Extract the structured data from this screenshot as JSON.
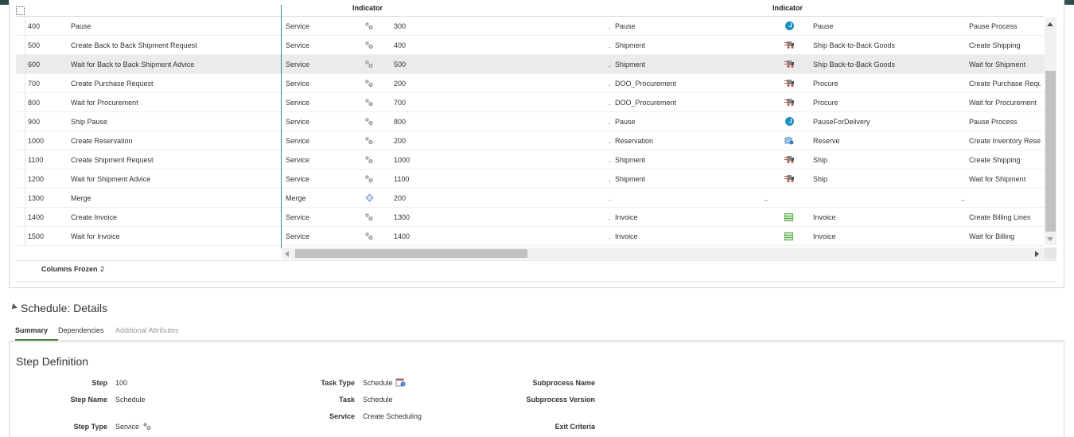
{
  "header": {
    "indicator_col_1": "Indicator",
    "indicator_col_2": "Indicator"
  },
  "rows": [
    {
      "step": "400",
      "name": "Pause",
      "type": "Service",
      "pred": "300",
      "task_type": "Pause",
      "ind": "clock",
      "task": "Pause",
      "service": "Pause Process"
    },
    {
      "step": "500",
      "name": "Create Back to Back Shipment Request",
      "type": "Service",
      "pred": "400",
      "task_type": "Shipment",
      "ind": "truck",
      "task": "Ship Back-to-Back Goods",
      "service": "Create Shipping"
    },
    {
      "step": "600",
      "name": "Wait for Back to Back Shipment Advice",
      "type": "Service",
      "pred": "500",
      "task_type": "Shipment",
      "ind": "truck",
      "task": "Ship Back-to-Back Goods",
      "service": "Wait for Shipment"
    },
    {
      "step": "700",
      "name": "Create Purchase Request",
      "type": "Service",
      "pred": "200",
      "task_type": "DOO_Procurement",
      "ind": "truck",
      "task": "Procure",
      "service": "Create Purchase Reque"
    },
    {
      "step": "800",
      "name": "Wait for Procurement",
      "type": "Service",
      "pred": "700",
      "task_type": "DOO_Procurement",
      "ind": "truck",
      "task": "Procure",
      "service": "Wait for Procurement"
    },
    {
      "step": "900",
      "name": "Ship Pause",
      "type": "Service",
      "pred": "800",
      "task_type": "Pause",
      "ind": "clock",
      "task": "PauseForDelivery",
      "service": "Pause Process"
    },
    {
      "step": "1000",
      "name": "Create Reservation",
      "type": "Service",
      "pred": "200",
      "task_type": "Reservation",
      "ind": "reserve",
      "task": "Reserve",
      "service": "Create Inventory Reser"
    },
    {
      "step": "1100",
      "name": "Create Shipment Request",
      "type": "Service",
      "pred": "1000",
      "task_type": "Shipment",
      "ind": "truck",
      "task": "Ship",
      "service": "Create Shipping"
    },
    {
      "step": "1200",
      "name": "Wait for Shipment Advice",
      "type": "Service",
      "pred": "1100",
      "task_type": "Shipment",
      "ind": "truck",
      "task": "Ship",
      "service": "Wait for Shipment"
    },
    {
      "step": "1300",
      "name": "Merge",
      "type": "Merge",
      "pred": "200",
      "task_type": "",
      "ind": "",
      "task": "",
      "service": ""
    },
    {
      "step": "1400",
      "name": "Create Invoice",
      "type": "Service",
      "pred": "1300",
      "task_type": "Invoice",
      "ind": "grid",
      "task": "Invoice",
      "service": "Create Billing Lines"
    },
    {
      "step": "1500",
      "name": "Wait for Invoice",
      "type": "Service",
      "pred": "1400",
      "task_type": "Invoice",
      "ind": "grid",
      "task": "Invoice",
      "service": "Wait for Billing"
    }
  ],
  "footer": {
    "frozen_label": "Columns Frozen",
    "frozen_value": "2"
  },
  "section": {
    "title": "Schedule: Details"
  },
  "tabs": [
    {
      "label": "Summary"
    },
    {
      "label": "Dependencies"
    },
    {
      "label": "Additional Attributes"
    }
  ],
  "details": {
    "title": "Step Definition",
    "step_label": "Step",
    "step_value": "100",
    "step_name_label": "Step Name",
    "step_name_value": "Schedule",
    "step_type_label": "Step Type",
    "step_type_value": "Service",
    "task_type_label": "Task Type",
    "task_type_value": "Schedule",
    "task_label": "Task",
    "task_value": "Schedule",
    "service_label": "Service",
    "service_value": "Create Scheduling",
    "subprocess_name_label": "Subprocess Name",
    "subprocess_version_label": "Subprocess Version",
    "exit_criteria_label": "Exit Criteria"
  },
  "colors": {
    "accent_teal": "#2b8a9a",
    "tab_active": "#4a7a36",
    "clock_blue": "#1d8fc2"
  }
}
